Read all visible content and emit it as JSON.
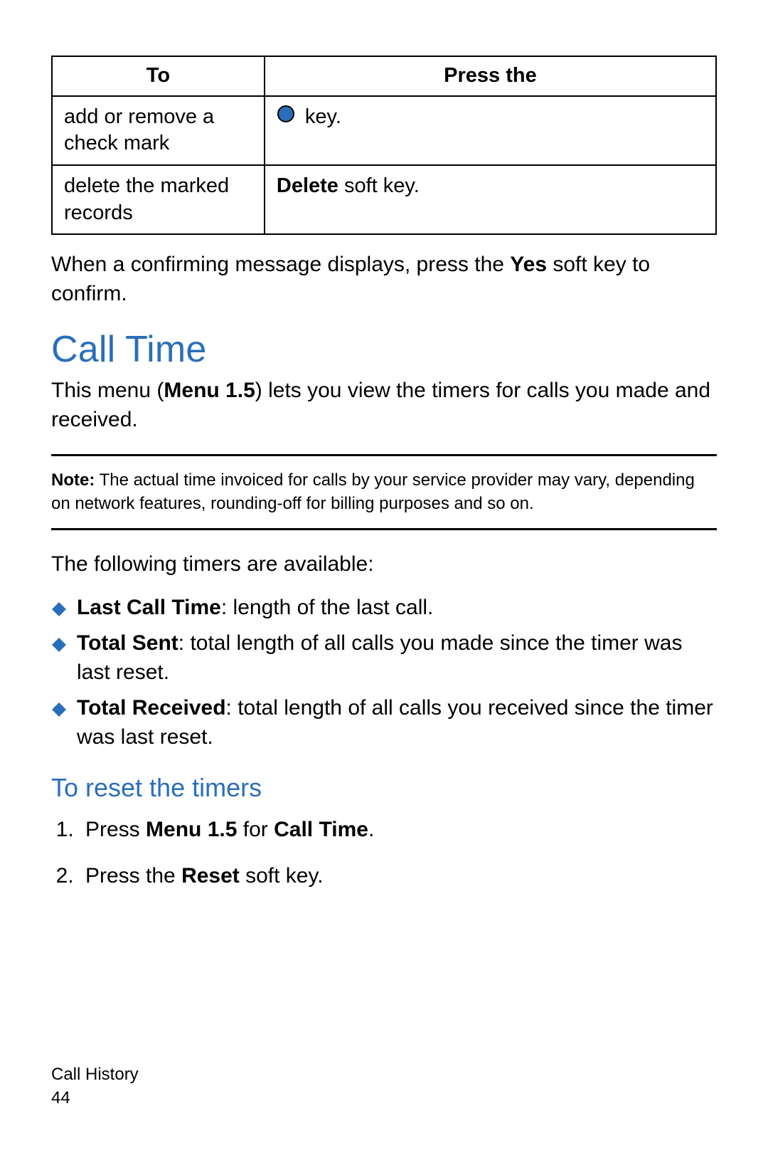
{
  "table": {
    "headers": [
      "To",
      "Press the"
    ],
    "rows": [
      {
        "to": "add or remove a check mark",
        "press_suffix": " key."
      },
      {
        "to": "delete the marked records",
        "press_bold": "Delete",
        "press_suffix": " soft key."
      }
    ]
  },
  "confirm_para": {
    "pre": "When a confirming message displays, press the ",
    "bold": "Yes",
    "post": " soft key to confirm."
  },
  "section_title": "Call Time",
  "intro_para": {
    "p1": "This menu (",
    "bold": "Menu 1.5",
    "p2": ") lets you view the timers for calls you made and received."
  },
  "note": {
    "label": "Note:",
    "text": " The actual time invoiced for calls by your service provider may vary, depending on network features, rounding-off for billing purposes and so on."
  },
  "timers_intro": "The following timers are available:",
  "timers": [
    {
      "bold": "Last Call Time",
      "rest": ": length of the last call."
    },
    {
      "bold": "Total Sent",
      "rest": ": total length of all calls you made since the timer was last reset."
    },
    {
      "bold": "Total Received",
      "rest": ": total length of all calls you received since the timer was last reset."
    }
  ],
  "sub_title": "To reset the timers",
  "steps": [
    {
      "p1": "Press ",
      "b1": "Menu 1.5",
      "p2": " for ",
      "b2": "Call Time",
      "p3": "."
    },
    {
      "p1": "Press the ",
      "b1": "Reset",
      "p2": " soft key.",
      "b2": "",
      "p3": ""
    }
  ],
  "footer": {
    "chapter": "Call History",
    "page": "44"
  },
  "colors": {
    "accent": "#2a6ebb"
  }
}
